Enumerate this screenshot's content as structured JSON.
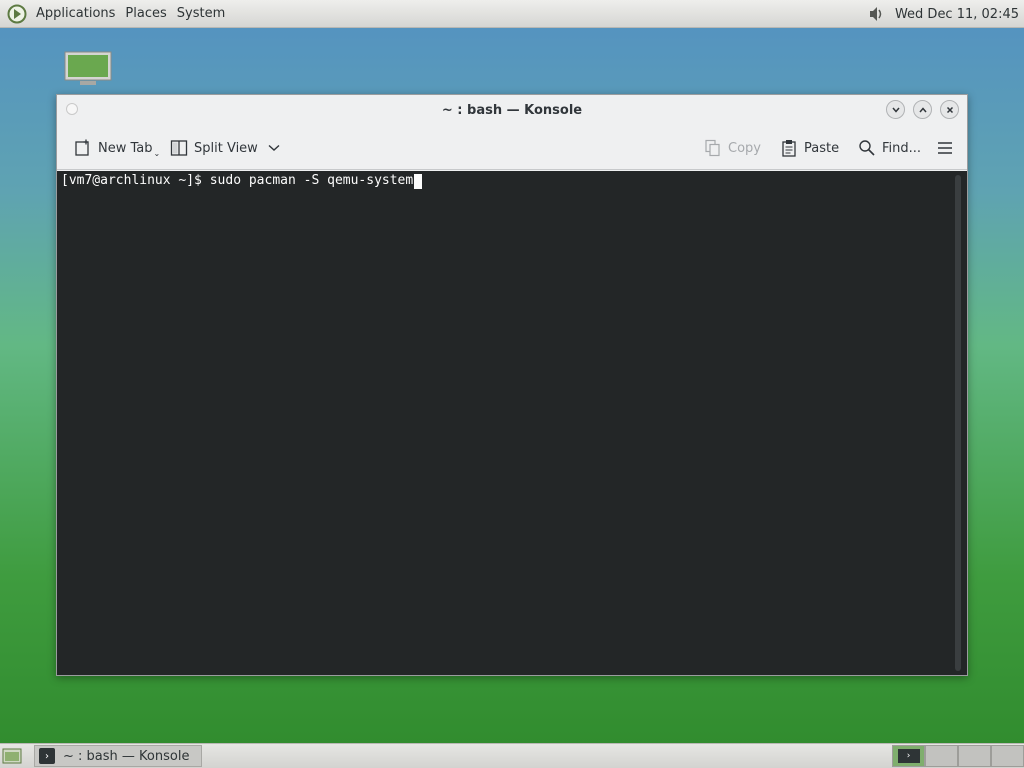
{
  "top_panel": {
    "menus": [
      "Applications",
      "Places",
      "System"
    ],
    "clock": "Wed Dec 11, 02:45"
  },
  "window": {
    "title": "~ : bash — Konsole",
    "toolbar": {
      "new_tab": "New Tab",
      "split_view": "Split View",
      "copy": "Copy",
      "paste": "Paste",
      "find": "Find..."
    }
  },
  "terminal": {
    "prompt": "[vm7@archlinux ~]$ ",
    "command": "sudo pacman -S qemu-system"
  },
  "bottom_panel": {
    "task_label": "~ : bash — Konsole"
  },
  "icons": {
    "logo": "gnome-foot-icon",
    "volume": "volume-icon",
    "computer": "computer-icon"
  }
}
